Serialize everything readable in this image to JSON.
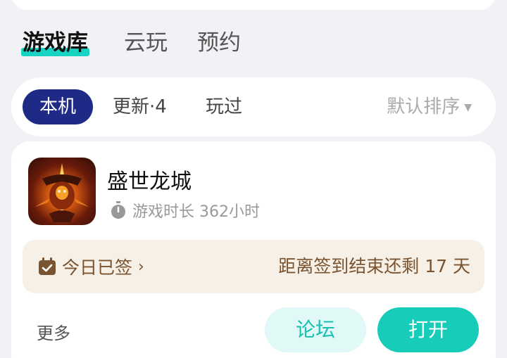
{
  "tabs": [
    {
      "label": "游戏库",
      "active": true
    },
    {
      "label": "云玩",
      "active": false
    },
    {
      "label": "预约",
      "active": false
    }
  ],
  "filters": [
    {
      "label": "本机",
      "active": true
    },
    {
      "label": "更新·4",
      "active": false
    },
    {
      "label": "玩过",
      "active": false
    }
  ],
  "sort_label": "默认排序",
  "game": {
    "icon": "game-icon",
    "title": "盛世龙城",
    "playtime": "游戏时长 362小时"
  },
  "checkin": {
    "status": "今日已签",
    "countdown": "距离签到结束还剩 17 天"
  },
  "actions": {
    "more": "更多",
    "forum": "论坛",
    "open": "打开"
  },
  "colors": {
    "accent_teal": "#17cdb9",
    "active_chip": "#1f2a86",
    "checkin_bg": "#f6f0e7",
    "checkin_text": "#7a5330"
  }
}
